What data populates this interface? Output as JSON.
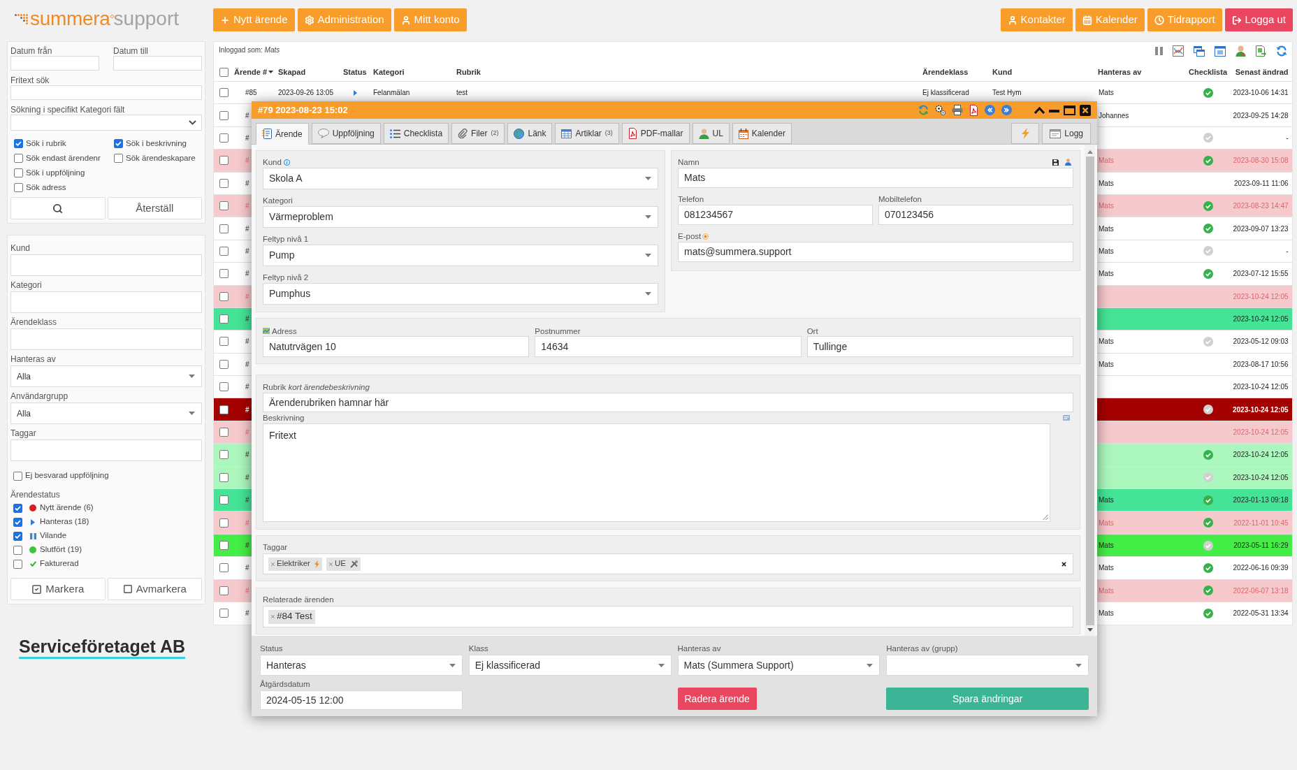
{
  "logo": {
    "name": "summera",
    "suffix": "support"
  },
  "nav_left": [
    {
      "label": "Nytt ärende",
      "kind": "primary"
    },
    {
      "label": "Administration",
      "kind": "primary"
    },
    {
      "label": "Mitt konto",
      "kind": "primary"
    }
  ],
  "nav_right": [
    {
      "label": "Kontakter",
      "kind": "primary"
    },
    {
      "label": "Kalender",
      "kind": "primary"
    },
    {
      "label": "Tidrapport",
      "kind": "primary"
    },
    {
      "label": "Logga ut",
      "kind": "danger"
    }
  ],
  "search_panel": {
    "date_from": "Datum från",
    "date_to": "Datum till",
    "freetext": "Fritext sök",
    "category_field": "Sökning i specifikt Kategori fält",
    "option_rows": [
      [
        {
          "label": "Sök i rubrik",
          "checked": true
        },
        {
          "label": "Sök i beskrivning",
          "checked": true
        }
      ],
      [
        {
          "label": "Sök endast ärendenr",
          "checked": false
        },
        {
          "label": "Sök ärendeskapare",
          "checked": false
        }
      ],
      [
        {
          "label": "Sök i uppföljning",
          "checked": false
        }
      ],
      [
        {
          "label": "Sök adress",
          "checked": false
        }
      ]
    ],
    "reset_button": "Återställ"
  },
  "filter_panel": {
    "fields": [
      {
        "label": "Kund",
        "kind": "text"
      },
      {
        "label": "Kategori",
        "kind": "text"
      },
      {
        "label": "Ärendeklass",
        "kind": "text"
      },
      {
        "label": "Hanteras av",
        "kind": "select",
        "value": "Alla"
      },
      {
        "label": "Användargrupp",
        "kind": "select",
        "value": "Alla"
      },
      {
        "label": "Taggar",
        "kind": "text"
      }
    ],
    "unanswered": {
      "label": "Ej besvarad uppföljning",
      "checked": false
    },
    "status_title": "Ärendestatus",
    "statuses": [
      {
        "label": "Nytt ärende (6)",
        "checked": true,
        "kind": "new"
      },
      {
        "label": "Hanteras (18)",
        "checked": true,
        "kind": "handling"
      },
      {
        "label": "Vilande",
        "checked": true,
        "kind": "paused"
      },
      {
        "label": "Slutfört (19)",
        "checked": false,
        "kind": "finished"
      },
      {
        "label": "Fakturerad",
        "checked": false,
        "kind": "invoiced"
      }
    ],
    "mark_button": "Markera",
    "unmark_button": "Avmarkera"
  },
  "company_name": "Serviceföretaget AB",
  "table": {
    "logged_in": "Inloggad som: *Mats*",
    "select_all": {
      "checked": false
    },
    "columns": [
      "Ärende #",
      "Skapad",
      "Status",
      "Kategori",
      "Rubrik",
      "Ärendeklass",
      "Kund",
      "Hanteras av",
      "Checklista",
      "Senast ändrad"
    ],
    "rows": [
      {
        "checked": false,
        "number": "#85",
        "created": "2023-09-26 13:05",
        "status": {
          "kind": "handling"
        },
        "category": "Felanmälan",
        "subject": "test",
        "case_class": "Ej klassificerad",
        "customer": "Test Hym",
        "handler": "Mats",
        "checklist_done": true,
        "modified": "2023-10-06 14:31",
        "color": "#ffffff"
      },
      {
        "checked": false,
        "number": "#",
        "handler": "Johannes",
        "modified": "2023-09-25 14:28",
        "color": "#ffffff"
      },
      {
        "checked": false,
        "number": "#",
        "checklist_done": false,
        "modified": "-",
        "color": "#ffffff"
      },
      {
        "checked": false,
        "number": "#",
        "handler": "Mats",
        "checklist_done": true,
        "modified": "2023-08-30 15:08",
        "color": "#f6c9cc"
      },
      {
        "checked": false,
        "number": "#",
        "handler": "Mats",
        "modified": "2023-09-11 11:06",
        "color": "#ffffff"
      },
      {
        "checked": false,
        "number": "#",
        "handler": "Mats",
        "checklist_done": true,
        "modified": "2023-08-23 14:47",
        "color": "#f6c9cc"
      },
      {
        "checked": false,
        "number": "#",
        "handler": "Mats",
        "checklist_done": true,
        "modified": "2023-09-07 13:23",
        "color": "#ffffff"
      },
      {
        "checked": false,
        "number": "#",
        "handler": "Mats",
        "checklist_done": false,
        "modified": "-",
        "color": "#ffffff"
      },
      {
        "checked": false,
        "number": "#",
        "handler": "Mats",
        "checklist_done": true,
        "modified": "2023-07-12 15:55",
        "color": "#ffffff"
      },
      {
        "checked": false,
        "number": "#",
        "modified": "2023-10-24 12:05",
        "color": "#f6c9cc"
      },
      {
        "checked": false,
        "number": "#",
        "modified": "2023-10-24 12:05",
        "color": "#45e395"
      },
      {
        "checked": false,
        "number": "#",
        "handler": "Mats",
        "checklist_done": false,
        "modified": "2023-05-12 09:03",
        "color": "#ffffff"
      },
      {
        "checked": false,
        "number": "#",
        "handler": "Mats",
        "modified": "2023-08-17 10:56",
        "color": "#ffffff"
      },
      {
        "checked": false,
        "number": "#",
        "modified": "2023-10-24 12:05",
        "color": "#ffffff"
      },
      {
        "checked": false,
        "number": "#",
        "checklist_done": false,
        "modified": "2023-10-24 12:05",
        "color": "#a50000"
      },
      {
        "checked": false,
        "number": "#",
        "modified": "2023-10-24 12:05",
        "color": "#f6c9cc"
      },
      {
        "checked": false,
        "number": "#",
        "checklist_done": true,
        "modified": "2023-10-24 12:05",
        "color": "#abf7bd"
      },
      {
        "checked": false,
        "number": "#",
        "checklist_done": false,
        "modified": "2023-10-24 12:05",
        "color": "#abf7bd"
      },
      {
        "checked": false,
        "number": "#",
        "handler": "Mats",
        "checklist_done": true,
        "modified": "2023-01-13 09:18",
        "color": "#45e395"
      },
      {
        "checked": false,
        "number": "#",
        "handler": "Mats",
        "checklist_done": true,
        "modified": "2022-11-01 10:45",
        "color": "#f6c9cc"
      },
      {
        "checked": false,
        "number": "#",
        "handler": "Mats",
        "checklist_done": false,
        "modified": "2023-05-11 16:29",
        "color": "#45ee47"
      },
      {
        "checked": false,
        "number": "#",
        "handler": "Mats",
        "checklist_done": true,
        "modified": "2022-06-16 09:39",
        "color": "#ffffff"
      },
      {
        "checked": false,
        "number": "#",
        "handler": "Mats",
        "checklist_done": true,
        "modified": "2022-06-07 13:18",
        "color": "#f6c9cc"
      },
      {
        "checked": false,
        "number": "#",
        "handler": "Mats",
        "checklist_done": true,
        "modified": "2022-05-31 13:34",
        "color": "#ffffff"
      }
    ]
  },
  "dialog": {
    "title": "#79 2023-08-23 15:02",
    "tabs": [
      {
        "label": "Ärende",
        "selected": true
      },
      {
        "label": "Uppföljning",
        "selected": false
      },
      {
        "label": "Checklista",
        "selected": false
      },
      {
        "label": "Filer",
        "count": "(2)",
        "selected": false
      },
      {
        "label": "Länk",
        "selected": false
      },
      {
        "label": "Artiklar",
        "count": "(3)",
        "selected": false
      },
      {
        "label": "PDF-mallar",
        "selected": false
      },
      {
        "label": "UL",
        "selected": false
      },
      {
        "label": "Kalender",
        "selected": false
      }
    ],
    "log_tab": {
      "label": "Logg",
      "selected": false
    },
    "customer_fields": [
      {
        "label": "Kund",
        "value": "Skola A"
      },
      {
        "label": "Kategori",
        "value": "Värmeproblem"
      },
      {
        "label": "Feltyp nivå 1",
        "value": "Pump"
      },
      {
        "label": "Feltyp nivå 2",
        "value": "Pumphus"
      }
    ],
    "contact": {
      "name": {
        "label": "Namn",
        "value": "Mats"
      },
      "phone": {
        "label": "Telefon",
        "value": "081234567"
      },
      "mobile": {
        "label": "Mobiltelefon",
        "value": "070123456"
      },
      "email": {
        "label": "E-post",
        "value": "mats@summera.support"
      }
    },
    "address_fields": [
      {
        "label": "Adress",
        "value": "Natutrvägen 10"
      },
      {
        "label": "Postnummer",
        "value": "14634"
      },
      {
        "label": "Ort",
        "value": "Tullinge"
      }
    ],
    "subject": {
      "label": "Rubrik *kort ärendebeskrivning*",
      "value": "Ärenderubriken hamnar här"
    },
    "description": {
      "label": "Beskrivning",
      "value": "Fritext"
    },
    "tags": {
      "label": "Taggar",
      "items": [
        {
          "label": "Elektriker"
        },
        {
          "label": "UE"
        }
      ]
    },
    "related": {
      "label": "Relaterade ärenden",
      "items": [
        {
          "label": "#84 Test"
        }
      ]
    },
    "footer": {
      "fields": [
        {
          "label": "Status",
          "value": "Hanteras"
        },
        {
          "label": "Klass",
          "value": "Ej klassificerad"
        },
        {
          "label": "Hanteras av",
          "value": "Mats (Summera Support)"
        },
        {
          "label": "Hanteras av (grupp)"
        }
      ],
      "due_date": {
        "label": "Åtgärdsdatum",
        "value": "2024-05-15 12:00"
      },
      "delete_button": "Radera ärende",
      "save_button": "Spara ändringar"
    }
  }
}
